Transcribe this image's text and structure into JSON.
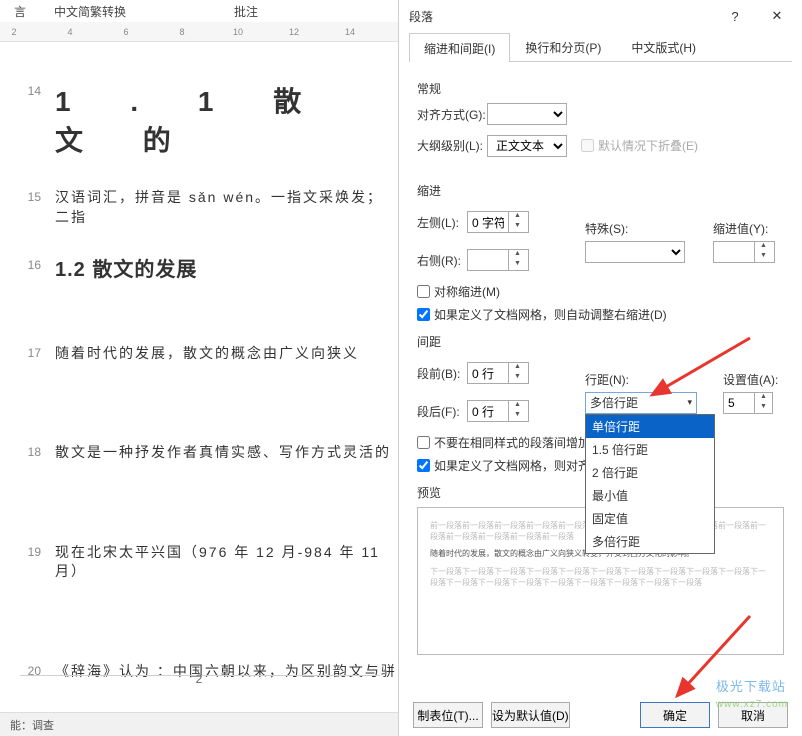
{
  "ribbon": {
    "tab1": "言",
    "tab2": "中文简繁转换",
    "tab3": "批注"
  },
  "ruler": [
    "2",
    "",
    "4",
    "",
    "6",
    "",
    "8",
    "",
    "10",
    "",
    "12",
    "",
    "14"
  ],
  "doc": {
    "l14": {
      "n": "14",
      "t": "1 . 1  散  文  的"
    },
    "l15": {
      "n": "15",
      "t": "汉语词汇，拼音是 sǎn wén。一指文采焕发；二指"
    },
    "l16": {
      "n": "16",
      "t": "1.2 散文的发展"
    },
    "l17": {
      "n": "17",
      "t": "随着时代的发展，散文的概念由广义向狭义"
    },
    "l18": {
      "n": "18",
      "t": "散文是一种抒发作者真情实感、写作方式灵活的"
    },
    "l19": {
      "n": "19",
      "t": "现在北宋太平兴国（976 年 12 月-984 年 11 月）"
    },
    "l20": {
      "n": "20",
      "t": "《辞海》认为 ：中国六朝以来，为区别韵文与骈"
    },
    "page": "2"
  },
  "status": "能：调查",
  "dialog": {
    "title": "段落",
    "tabs": {
      "t1": "缩进和间距(I)",
      "t2": "换行和分页(P)",
      "t3": "中文版式(H)"
    },
    "s_general": "常规",
    "align_lbl": "对齐方式(G):",
    "outline_lbl": "大纲级别(L):",
    "outline_val": "正文文本",
    "collapse_lbl": "默认情况下折叠(E)",
    "s_indent": "缩进",
    "left_lbl": "左侧(L):",
    "left_val": "0 字符",
    "right_lbl": "右侧(R):",
    "right_val": "",
    "special_lbl": "特殊(S):",
    "indentval_lbl": "缩进值(Y):",
    "mirror_lbl": "对称缩进(M)",
    "autogrid_indent_lbl": "如果定义了文档网格，则自动调整右缩进(D)",
    "s_spacing": "间距",
    "before_lbl": "段前(B):",
    "before_val": "0 行",
    "after_lbl": "段后(F):",
    "after_val": "0 行",
    "linesp_lbl": "行距(N):",
    "linesp_val": "多倍行距",
    "setval_lbl": "设置值(A):",
    "setval_val": "5",
    "nospace_lbl": "不要在相同样式的段落间增加间",
    "autogrid_sp_lbl": "如果定义了文档网格，则对齐到",
    "dd": {
      "o1": "单倍行距",
      "o2": "1.5 倍行距",
      "o3": "2 倍行距",
      "o4": "最小值",
      "o5": "固定值",
      "o6": "多倍行距"
    },
    "s_preview": "预览",
    "preview_gray1": "前一段落前一段落前一段落前一段落前一段落前一段落前一段落前一段落前一段落前一段落前一段落前一段落前一段落前一段落前一段落",
    "preview_text": "随着时代的发展，散文的概念由广义向狭义转变，并受到西方文化的影响。",
    "preview_gray2": "下一段落下一段落下一段落下一段落下一段落下一段落下一段落下一段落下一段落下一段落下一段落下一段落下一段落下一段落下一段落下一段落下一段落下一段落下一段落",
    "btn_tabs": "制表位(T)...",
    "btn_default": "设为默认值(D)",
    "btn_ok": "确定",
    "btn_cancel": "取消"
  },
  "watermark": {
    "w1": "极光下载站",
    "w2": "www.xz7.com"
  }
}
